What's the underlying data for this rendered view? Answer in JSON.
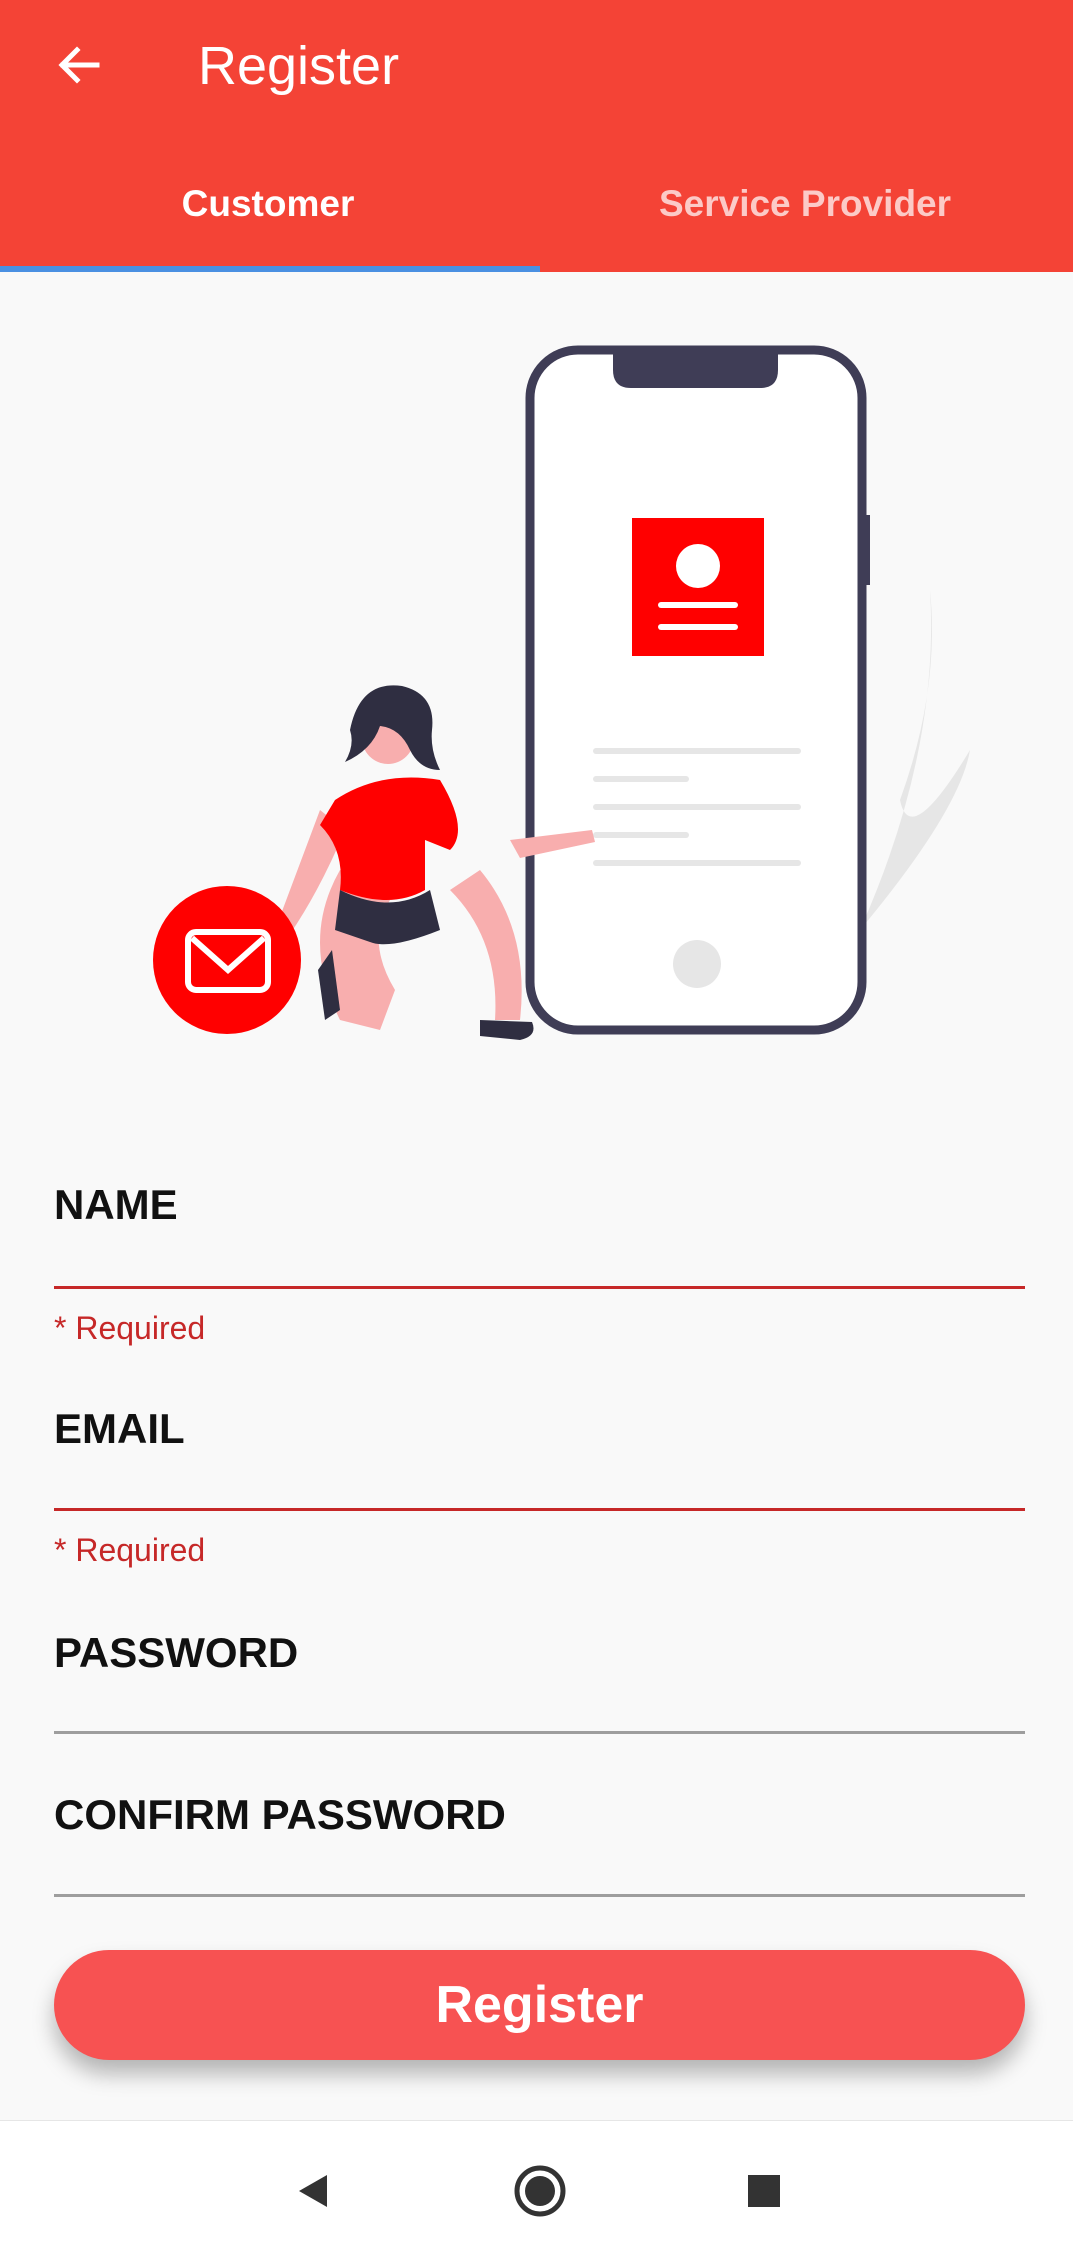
{
  "appbar": {
    "title": "Register",
    "back_icon": "arrow-left-icon",
    "color": "#f44336"
  },
  "tabs": [
    {
      "label": "Customer",
      "selected": true
    },
    {
      "label": "Service Provider",
      "selected": false
    }
  ],
  "illustration": {
    "icons": [
      "phone-icon",
      "profile-card-icon",
      "mail-icon",
      "person-illustration"
    ]
  },
  "form": {
    "name": {
      "label": "NAME",
      "value": "",
      "error": "* Required"
    },
    "email": {
      "label": "EMAIL",
      "value": "",
      "error": "* Required"
    },
    "password": {
      "label": "PASSWORD",
      "value": ""
    },
    "confirm_password": {
      "label": "CONFIRM PASSWORD",
      "value": ""
    }
  },
  "register_button": {
    "label": "Register",
    "color": "#f75252"
  },
  "navbar": {
    "icons": [
      "back-triangle-icon",
      "home-circle-icon",
      "recents-square-icon"
    ]
  },
  "colors": {
    "error": "#c62828",
    "indicator": "#4a90e2",
    "accent_red": "#ff0000"
  }
}
